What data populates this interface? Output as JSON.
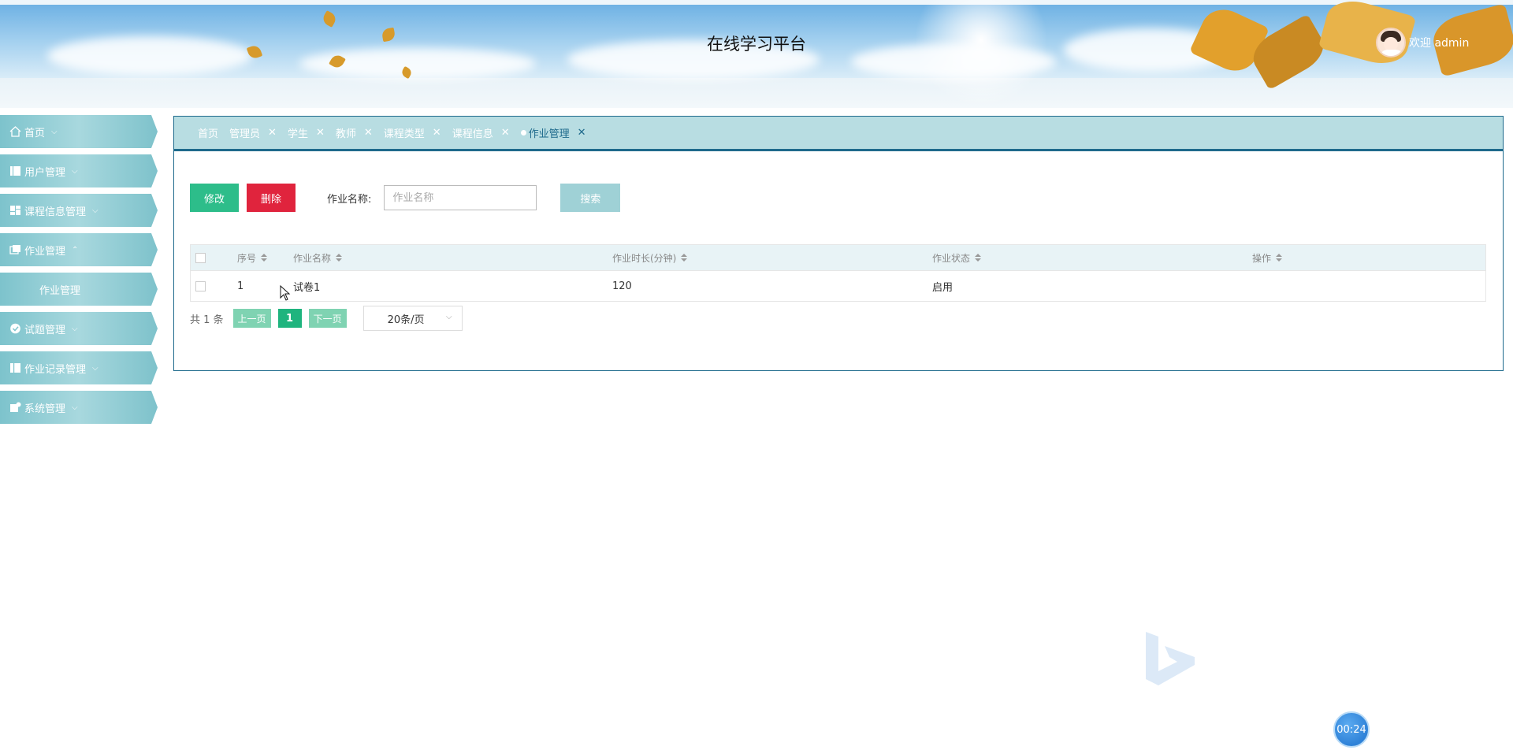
{
  "header": {
    "title": "在线学习平台",
    "welcome": "欢迎 admin"
  },
  "sidebar": {
    "items": [
      {
        "label": "首页",
        "icon": "home-icon",
        "chevron": "⌵"
      },
      {
        "label": "用户管理",
        "icon": "user-table-icon",
        "chevron": "⌵"
      },
      {
        "label": "课程信息管理",
        "icon": "grid-icon",
        "chevron": "⌵"
      },
      {
        "label": "作业管理",
        "icon": "folder-icon",
        "chevron": "⌃"
      },
      {
        "label": "试题管理",
        "icon": "check-circle-icon",
        "chevron": "⌵"
      },
      {
        "label": "作业记录管理",
        "icon": "book-icon",
        "chevron": "⌵"
      },
      {
        "label": "系统管理",
        "icon": "settings-doc-icon",
        "chevron": "⌵"
      }
    ],
    "sub_item": "作业管理"
  },
  "tabs": [
    {
      "label": "首页",
      "closable": false
    },
    {
      "label": "管理员",
      "closable": true
    },
    {
      "label": "学生",
      "closable": true
    },
    {
      "label": "教师",
      "closable": true
    },
    {
      "label": "课程类型",
      "closable": true
    },
    {
      "label": "课程信息",
      "closable": true
    },
    {
      "label": "作业管理",
      "closable": true,
      "active": true
    }
  ],
  "tab_close": "✕",
  "toolbar": {
    "edit_label": "修改",
    "delete_label": "删除",
    "search_label": "作业名称:",
    "search_placeholder": "作业名称",
    "search_button": "搜索"
  },
  "table": {
    "headers": [
      "序号",
      "作业名称",
      "作业时长(分钟)",
      "作业状态",
      "操作"
    ],
    "rows": [
      {
        "index": "1",
        "name": "试卷1",
        "duration": "120",
        "status": "启用",
        "action": ""
      }
    ]
  },
  "pager": {
    "total": "共 1 条",
    "prev": "上一页",
    "page": "1",
    "next": "下一页",
    "page_size": "20条/页"
  },
  "overlay": {
    "timer": "00:24"
  },
  "colors": {
    "accent": "#1e6a8c",
    "edit": "#2dbd8a",
    "delete": "#e0243d",
    "sidebar": "#7dc3cc",
    "tabbar": "#b8dde2"
  }
}
